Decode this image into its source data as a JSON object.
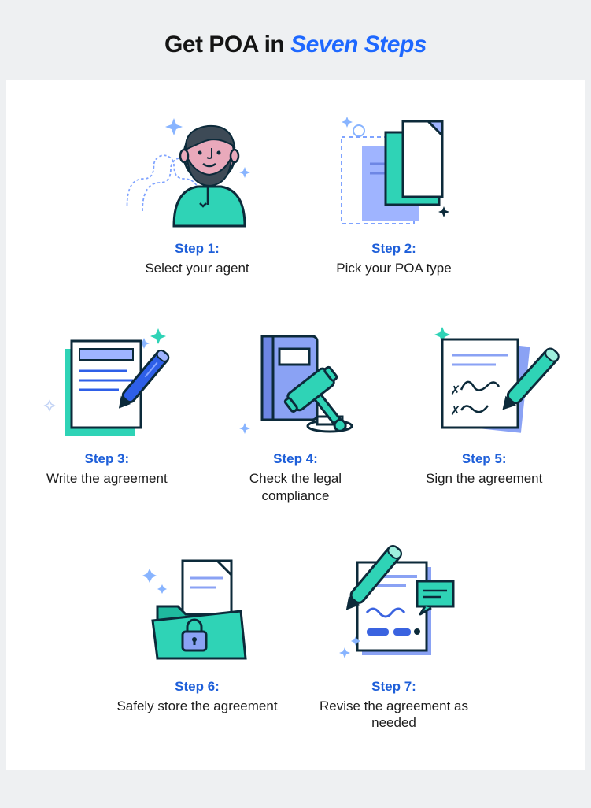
{
  "title": {
    "prefix": "Get POA in ",
    "accent": "Seven Steps"
  },
  "steps": [
    {
      "label": "Step 1:",
      "desc": "Select your agent"
    },
    {
      "label": "Step 2:",
      "desc": "Pick your POA type"
    },
    {
      "label": "Step 3:",
      "desc": "Write the agreement"
    },
    {
      "label": "Step 4:",
      "desc": "Check the legal compliance"
    },
    {
      "label": "Step 5:",
      "desc": "Sign the agreement"
    },
    {
      "label": "Step 6:",
      "desc": "Safely store the agreement"
    },
    {
      "label": "Step 7:",
      "desc": "Revise the agreement as needed"
    }
  ]
}
